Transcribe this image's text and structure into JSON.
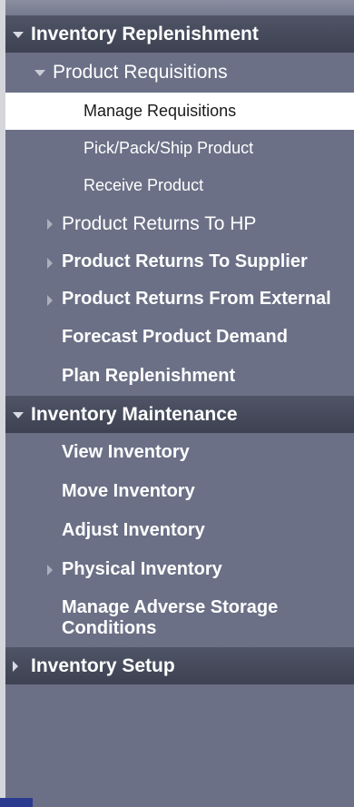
{
  "nav": {
    "sections": [
      {
        "label": "Inventory Replenishment",
        "expanded": true,
        "children": [
          {
            "label": "Product Requisitions",
            "expanded": true,
            "children": [
              {
                "label": "Manage Requisitions",
                "active": true
              },
              {
                "label": "Pick/Pack/Ship Product"
              },
              {
                "label": "Receive Product"
              }
            ]
          },
          {
            "label": "Product Returns To HP",
            "expandable": true
          },
          {
            "label": "Product Returns To Supplier",
            "expandable": true
          },
          {
            "label": "Product Returns From External",
            "expandable": true
          },
          {
            "label": "Forecast Product Demand"
          },
          {
            "label": "Plan Replenishment"
          }
        ]
      },
      {
        "label": "Inventory Maintenance",
        "expanded": true,
        "children": [
          {
            "label": "View Inventory"
          },
          {
            "label": "Move Inventory"
          },
          {
            "label": "Adjust Inventory"
          },
          {
            "label": "Physical Inventory",
            "expandable": true
          },
          {
            "label": "Manage Adverse Storage Conditions"
          }
        ]
      },
      {
        "label": "Inventory Setup",
        "expanded": false
      }
    ]
  },
  "colors": {
    "panel": "#6b7086",
    "section_header": "#45495a",
    "active_bg": "#ffffff",
    "text": "#ffffff",
    "accent": "#2a3b8f"
  }
}
